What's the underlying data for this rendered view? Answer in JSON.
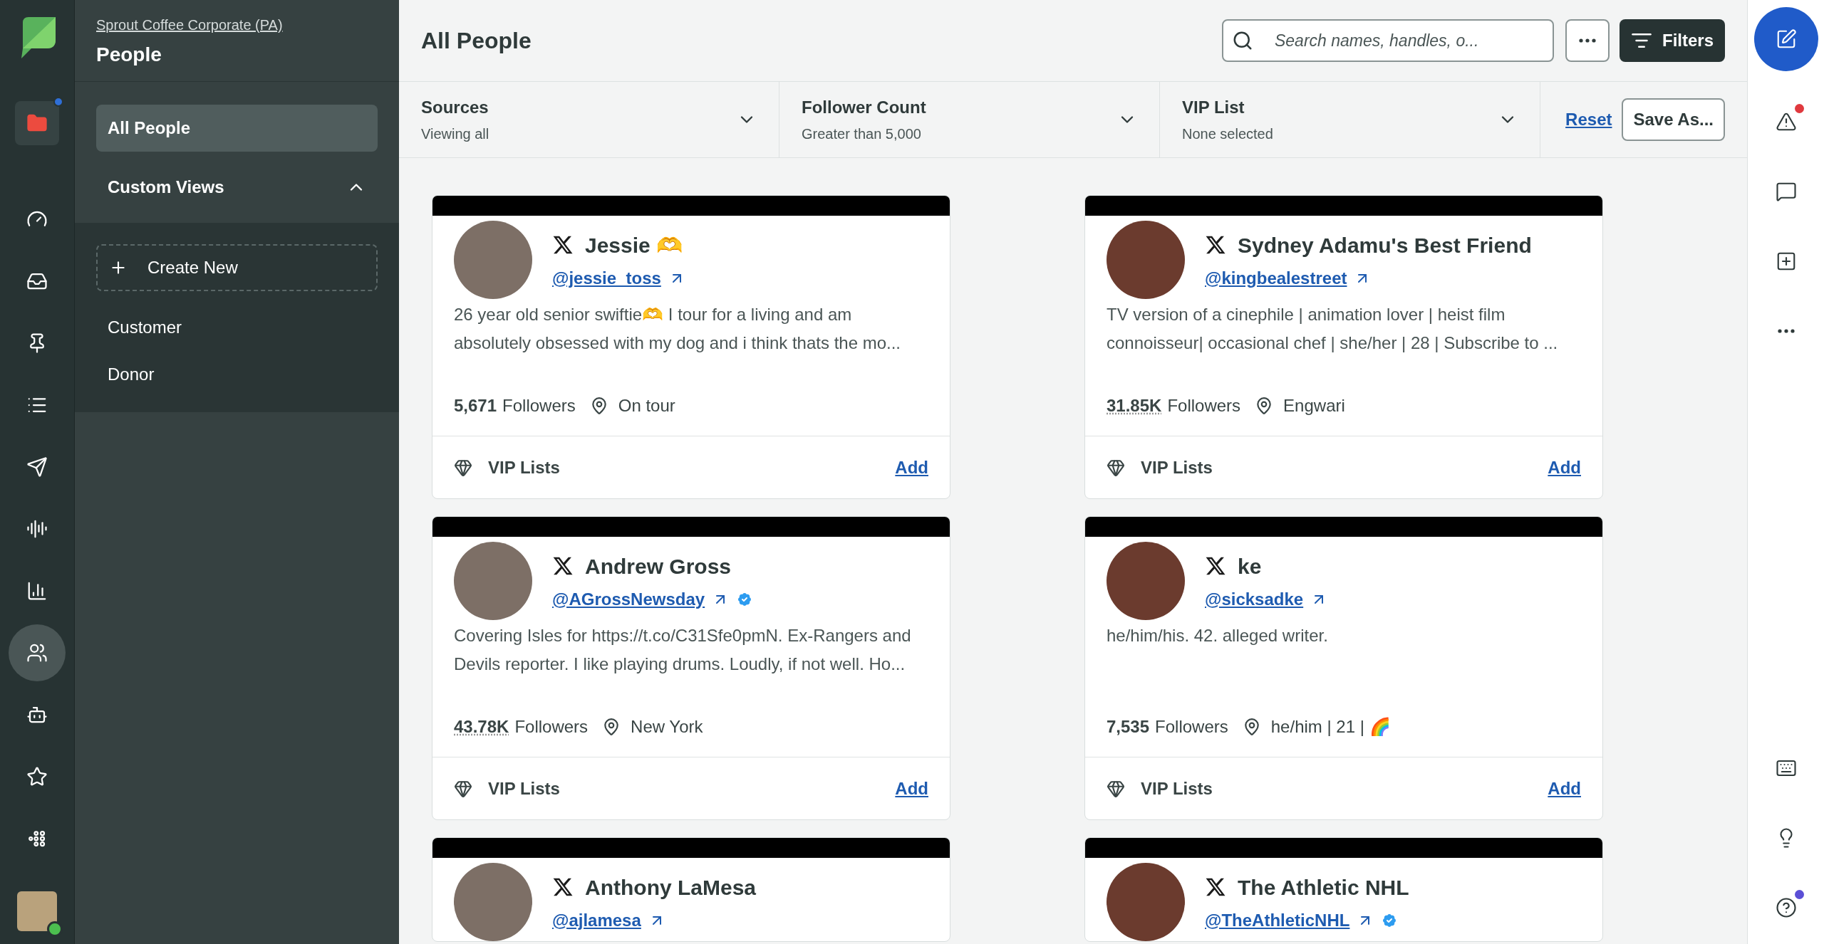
{
  "left_rail": {
    "items": [
      {
        "selected": false,
        "badge": true,
        "color": "#2f6fd6"
      },
      {
        "selected": false,
        "badge": false
      },
      {
        "selected": false,
        "badge": false
      },
      {
        "selected": false,
        "badge": false
      },
      {
        "selected": false,
        "badge": false
      },
      {
        "selected": false,
        "badge": false
      },
      {
        "selected": false,
        "badge": false
      },
      {
        "selected": false,
        "badge": false
      },
      {
        "selected": true,
        "badge": false
      },
      {
        "selected": false,
        "badge": false
      },
      {
        "selected": false,
        "badge": false
      },
      {
        "selected": false,
        "badge": false
      }
    ],
    "user": {
      "online": true
    }
  },
  "sidebar": {
    "account": "Sprout Coffee Corporate (PA)",
    "title": "People",
    "nav": [
      {
        "label": "All People",
        "selected": true
      }
    ],
    "custom_views": {
      "label": "Custom Views",
      "expanded": true,
      "create_label": "Create New",
      "items": [
        {
          "label": "Customer",
          "selected": false
        },
        {
          "label": "Donor",
          "selected": false
        }
      ]
    }
  },
  "header": {
    "title": "All People",
    "search": {
      "placeholder": "Search names, handles, o..."
    },
    "filters_button": "Filters"
  },
  "filter_bar": {
    "filters": [
      {
        "label": "Sources",
        "value": "Viewing all"
      },
      {
        "label": "Follower Count",
        "value": "Greater than 5,000"
      },
      {
        "label": "VIP List",
        "value": "None selected"
      }
    ],
    "reset": "Reset",
    "save": "Save As..."
  },
  "cards": [
    {
      "name": "Jessie 🫶",
      "handle": "@jessie_toss",
      "verified": false,
      "bio": "26 year old senior swiftie🫶 I tour for a living and am absolutely obsessed with my dog and i think thats the mo...",
      "followers": "5,671",
      "abbreviated": false,
      "followers_label": "Followers",
      "location": "On tour",
      "vip_label": "VIP Lists",
      "add": "Add"
    },
    {
      "name": "Sydney Adamu's Best Friend",
      "handle": "@kingbealestreet",
      "verified": false,
      "bio": "TV version of a cinephile | animation lover | heist film connoisseur| occasional chef | she/her | 28 | Subscribe to ...",
      "followers": "31.85K",
      "abbreviated": true,
      "followers_label": "Followers",
      "location": "Engwari",
      "vip_label": "VIP Lists",
      "add": "Add"
    },
    {
      "name": "Andrew Gross",
      "handle": "@AGrossNewsday",
      "verified": true,
      "bio": "Covering Isles for https://t.co/C31Sfe0pmN. Ex-Rangers and Devils reporter. I like playing drums. Loudly, if not well. Ho...",
      "followers": "43.78K",
      "abbreviated": true,
      "followers_label": "Followers",
      "location": "New York",
      "vip_label": "VIP Lists",
      "add": "Add"
    },
    {
      "name": "ke",
      "handle": "@sicksadke",
      "verified": false,
      "bio": "he/him/his. 42. alleged writer.",
      "followers": "7,535",
      "abbreviated": false,
      "followers_label": "Followers",
      "location": "he/him | 21 | 🌈",
      "vip_label": "VIP Lists",
      "add": "Add"
    },
    {
      "name": "Anthony LaMesa",
      "handle": "@ajlamesa",
      "verified": false
    },
    {
      "name": "The Athletic NHL",
      "handle": "@TheAthleticNHL",
      "verified": true
    }
  ],
  "right_rail": {
    "items": [
      {
        "badge": false
      },
      {
        "badge": true,
        "color": "#e0393e"
      },
      {
        "badge": false
      },
      {
        "badge": false
      },
      {
        "badge": false
      },
      {
        "badge": false
      },
      {
        "badge": false
      },
      {
        "badge": true,
        "color": "#5b4fd6"
      }
    ]
  }
}
